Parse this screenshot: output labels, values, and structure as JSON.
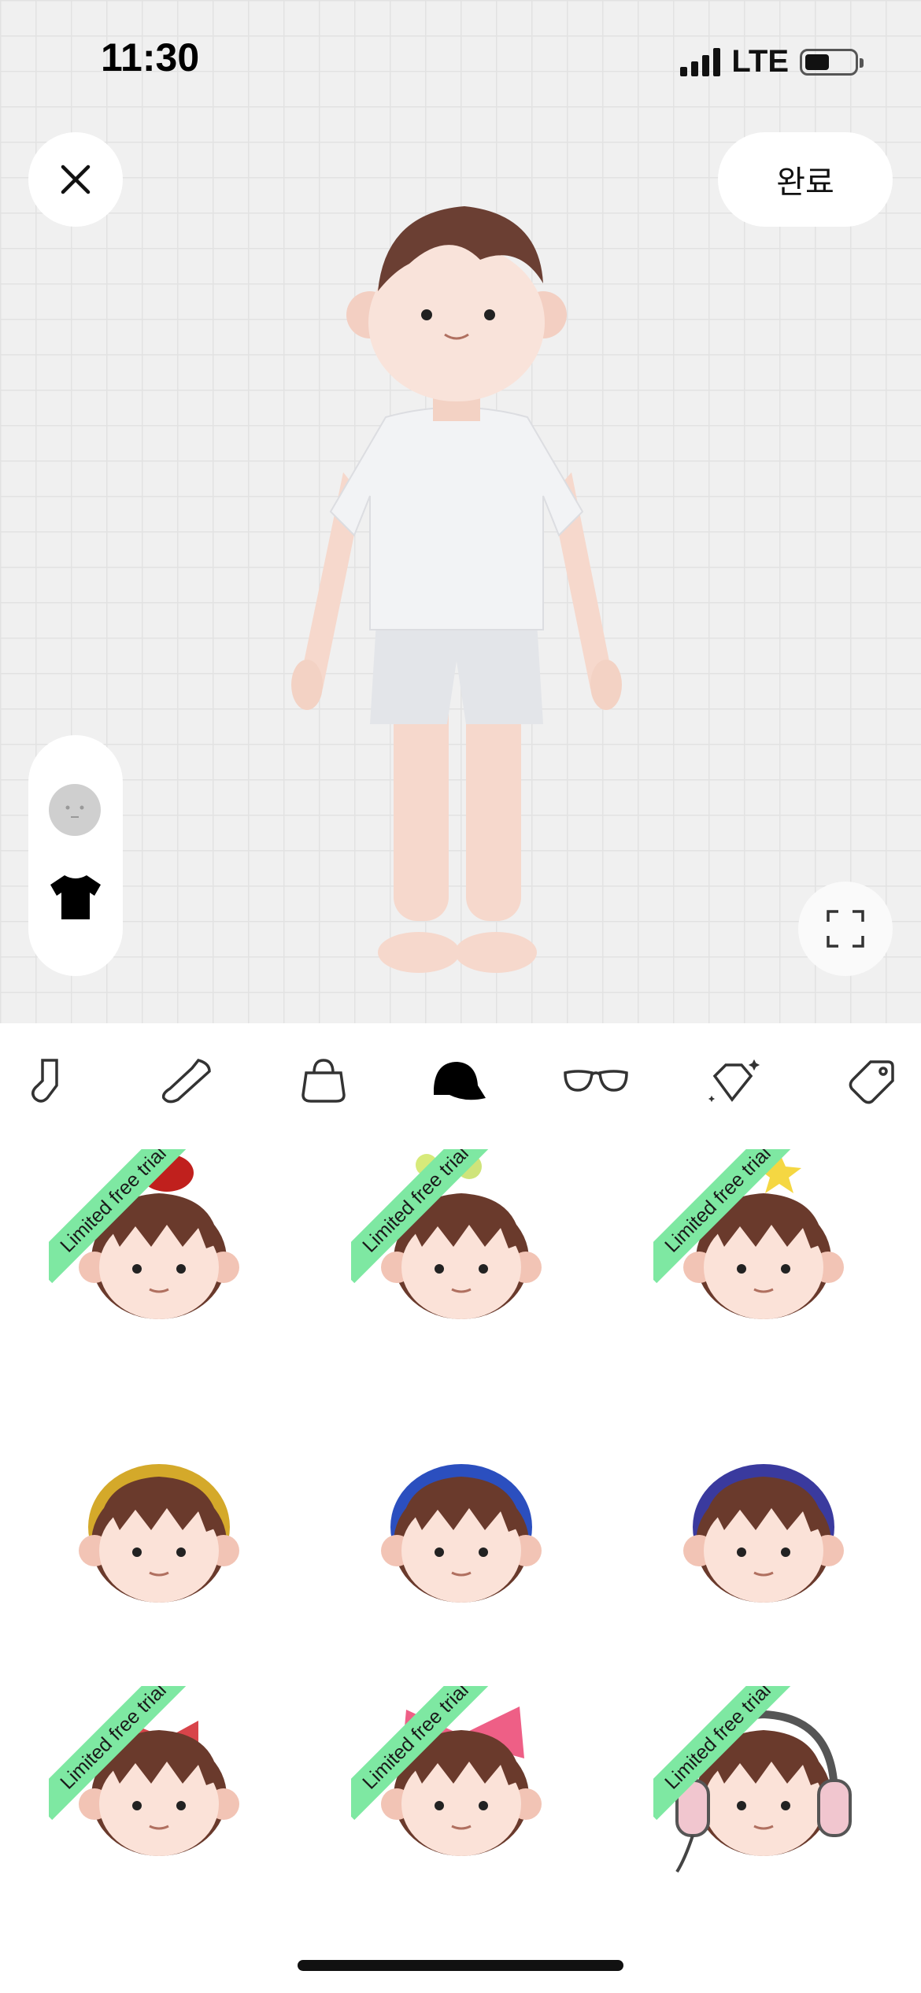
{
  "status_bar": {
    "time": "11:30",
    "network": "LTE"
  },
  "header": {
    "done_label": "완료"
  },
  "side_tabs": [
    {
      "icon": "face-icon"
    },
    {
      "icon": "shirt-icon"
    }
  ],
  "categories": [
    {
      "icon": "sock-icon",
      "selected": false
    },
    {
      "icon": "shoe-icon",
      "selected": false
    },
    {
      "icon": "bag-icon",
      "selected": false
    },
    {
      "icon": "cap-icon",
      "selected": true
    },
    {
      "icon": "glasses-icon",
      "selected": false
    },
    {
      "icon": "gem-icon",
      "selected": false
    },
    {
      "icon": "tag-icon",
      "selected": false
    }
  ],
  "items": [
    {
      "accessory": "red-apple",
      "badge": "Limited free trial"
    },
    {
      "accessory": "green-antenna",
      "badge": "Limited free trial"
    },
    {
      "accessory": "yellow-star",
      "badge": "Limited free trial"
    },
    {
      "accessory": "yellow-headband",
      "badge": ""
    },
    {
      "accessory": "blue-headband",
      "badge": ""
    },
    {
      "accessory": "navy-headband",
      "badge": ""
    },
    {
      "accessory": "red-small-bow",
      "badge": "Limited free trial"
    },
    {
      "accessory": "pink-big-bow",
      "badge": "Limited free trial"
    },
    {
      "accessory": "pink-headphones",
      "badge": "Limited free trial"
    }
  ],
  "colors": {
    "accent_badge": "#7ee8a2",
    "stage_bg": "#f0f0f0"
  }
}
